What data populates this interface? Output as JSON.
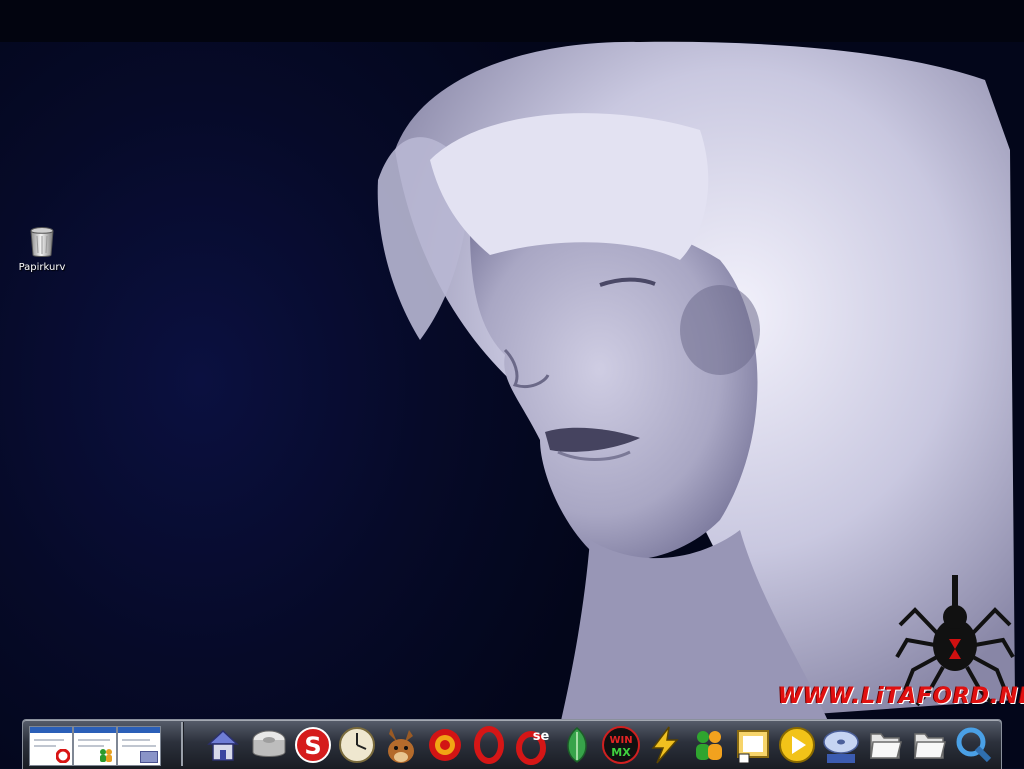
{
  "wallpaper": {
    "watermark": "WWW.LiTAFORD.NET",
    "colors": {
      "background": "#060a28",
      "hair": "#d8d7ec",
      "watermark": "#e01010"
    }
  },
  "desktop_icons": [
    {
      "label": "Papirkurv",
      "icon": "trash-can-icon"
    }
  ],
  "dock": {
    "task_thumbnails": [
      {
        "icon": "opera-window-thumbnail"
      },
      {
        "icon": "messenger-window-thumbnail"
      },
      {
        "icon": "explorer-window-thumbnail"
      }
    ],
    "launchers": [
      {
        "icon": "home-icon"
      },
      {
        "icon": "drive-icon"
      },
      {
        "icon": "skype-icon",
        "glyph": "S"
      },
      {
        "icon": "clock-icon"
      },
      {
        "icon": "emule-donkey-icon"
      },
      {
        "icon": "target-ring-icon"
      },
      {
        "icon": "opera-icon"
      },
      {
        "icon": "opera-se-icon",
        "glyph": "se"
      },
      {
        "icon": "leaf-icon"
      },
      {
        "icon": "winmx-icon",
        "glyph": "WIN MX"
      },
      {
        "icon": "winamp-icon"
      },
      {
        "icon": "msn-messenger-icon"
      },
      {
        "icon": "photo-frame-icon"
      },
      {
        "icon": "media-player-icon"
      },
      {
        "icon": "dvd-video-icon"
      },
      {
        "icon": "folder-icon"
      },
      {
        "icon": "folder-icon"
      },
      {
        "icon": "network-tools-icon"
      }
    ]
  }
}
